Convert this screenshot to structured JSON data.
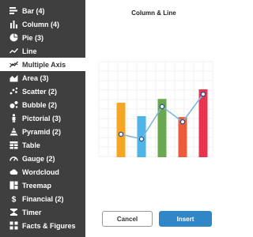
{
  "sidebar": {
    "items": [
      {
        "label": "Bar (4)",
        "icon": "bar-chart-icon",
        "active": false
      },
      {
        "label": "Column (4)",
        "icon": "column-chart-icon",
        "active": false
      },
      {
        "label": "Pie (3)",
        "icon": "pie-chart-icon",
        "active": false
      },
      {
        "label": "Line",
        "icon": "line-chart-icon",
        "active": false
      },
      {
        "label": "Multiple Axis",
        "icon": "multiple-axis-icon",
        "active": true
      },
      {
        "label": "Area (3)",
        "icon": "area-chart-icon",
        "active": false
      },
      {
        "label": "Scatter (2)",
        "icon": "scatter-chart-icon",
        "active": false
      },
      {
        "label": "Bubble (2)",
        "icon": "bubble-chart-icon",
        "active": false
      },
      {
        "label": "Pictorial (3)",
        "icon": "pictorial-chart-icon",
        "active": false
      },
      {
        "label": "Pyramid (2)",
        "icon": "pyramid-chart-icon",
        "active": false
      },
      {
        "label": "Table",
        "icon": "table-icon",
        "active": false
      },
      {
        "label": "Gauge (2)",
        "icon": "gauge-icon",
        "active": false
      },
      {
        "label": "Wordcloud",
        "icon": "wordcloud-icon",
        "active": false
      },
      {
        "label": "Treemap",
        "icon": "treemap-icon",
        "active": false
      },
      {
        "label": "Financial (2)",
        "icon": "dollar-icon",
        "active": false
      },
      {
        "label": "Timer",
        "icon": "timer-icon",
        "active": false
      },
      {
        "label": "Facts & Figures",
        "icon": "facts-figures-icon",
        "active": false
      }
    ]
  },
  "preview": {
    "title": "Column & Line"
  },
  "chart_data": {
    "type": "bar",
    "title": "Column & Line",
    "xlabel": "",
    "ylabel": "",
    "grid": true,
    "categories": [
      "",
      "",
      "",
      "",
      ""
    ],
    "ylim": [
      0,
      1
    ],
    "series": [
      {
        "type": "bar",
        "values": [
          0.57,
          0.43,
          0.61,
          0.42,
          0.71
        ],
        "colors": [
          "#f6a623",
          "#4fb5e8",
          "#6aa84f",
          "#ef5b3a",
          "#e8344e"
        ]
      },
      {
        "type": "line",
        "values": [
          0.24,
          0.19,
          0.53,
          0.37,
          0.66
        ],
        "color": "#7fb6dd",
        "point_color": "#2d4f8c"
      }
    ]
  },
  "buttons": {
    "cancel_label": "Cancel",
    "insert_label": "Insert"
  },
  "colors": {
    "sidebar_bg": "#3f3f3f",
    "insert_button": "#2f87c8"
  }
}
